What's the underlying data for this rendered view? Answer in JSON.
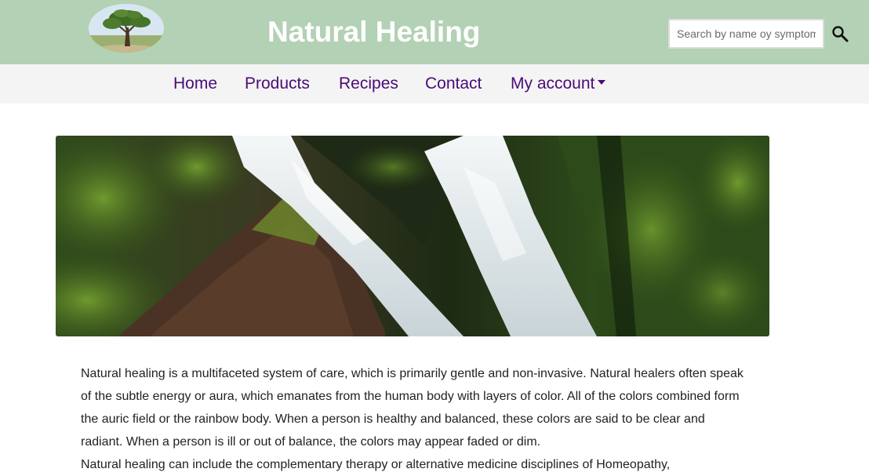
{
  "header": {
    "title": "Natural Healing",
    "logo_icon": "tree-logo-icon",
    "background_color": "#b3d1b4"
  },
  "search": {
    "placeholder": "Search by name oy symptom",
    "button_icon": "search-icon"
  },
  "nav": {
    "items": [
      {
        "label": "Home"
      },
      {
        "label": "Products"
      },
      {
        "label": "Recipes"
      },
      {
        "label": "Contact"
      },
      {
        "label": "My account",
        "dropdown_icon": "caret-down-icon"
      }
    ],
    "link_color": "#4b0b78",
    "background_color": "#f4f4f4"
  },
  "hero": {
    "image_subject": "waterfall-image"
  },
  "content": {
    "paragraph_lines": [
      "Natural healing is a multifaceted system of care, which is primarily gentle and non-invasive. Natural healers often speak",
      "of the subtle energy or aura, which emanates from the human body with layers of color. All of the colors combined form",
      "the auric field or the rainbow body. When a person is healthy and balanced, these colors are said to be clear and",
      "radiant. When a person is ill or out of balance, the colors may appear faded or dim.",
      "Natural healing can include the complementary therapy or alternative medicine disciplines of Homeopathy,"
    ]
  }
}
